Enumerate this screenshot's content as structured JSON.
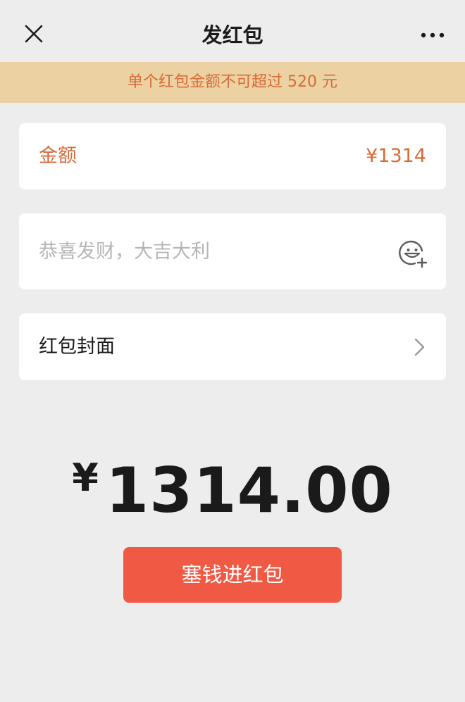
{
  "nav": {
    "title": "发红包",
    "close_icon": "close-icon",
    "more_icon": "more-icon"
  },
  "banner": {
    "text": "单个红包金额不可超过 520 元"
  },
  "amount": {
    "label": "金额",
    "value": "¥1314"
  },
  "greeting": {
    "placeholder": "恭喜发财，大吉大利",
    "value": "",
    "icon": "emoji-add-icon"
  },
  "cover": {
    "label": "红包封面",
    "icon": "chevron-right-icon"
  },
  "total": {
    "currency": "¥",
    "value": "1314.00"
  },
  "submit": {
    "label": "塞钱进红包"
  },
  "colors": {
    "background": "#ededed",
    "banner_bg": "#ecd2a2",
    "accent": "#d96a38",
    "button": "#f05a44",
    "card": "#ffffff"
  }
}
